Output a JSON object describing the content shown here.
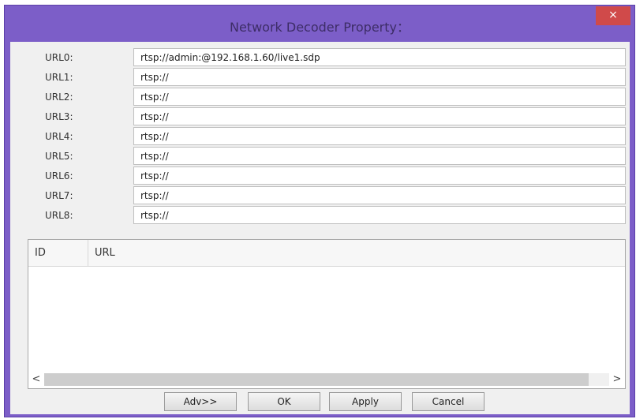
{
  "window": {
    "title": "Network Decoder Property：",
    "close_glyph": "×"
  },
  "urls": [
    {
      "label": "URL0:",
      "value": "rtsp://admin:@192.168.1.60/live1.sdp"
    },
    {
      "label": "URL1:",
      "value": "rtsp://"
    },
    {
      "label": "URL2:",
      "value": "rtsp://"
    },
    {
      "label": "URL3:",
      "value": "rtsp://"
    },
    {
      "label": "URL4:",
      "value": "rtsp://"
    },
    {
      "label": "URL5:",
      "value": "rtsp://"
    },
    {
      "label": "URL6:",
      "value": "rtsp://"
    },
    {
      "label": "URL7:",
      "value": "rtsp://"
    },
    {
      "label": "URL8:",
      "value": "rtsp://"
    }
  ],
  "list": {
    "columns": [
      "ID",
      "URL"
    ],
    "scroll_left": "<",
    "scroll_right": ">"
  },
  "buttons": {
    "adv": "Adv>>",
    "ok": "OK",
    "apply": "Apply",
    "cancel": "Cancel"
  },
  "colors": {
    "titlebar": "#7c5ec8",
    "close_button": "#d04a4a",
    "client_bg": "#f0f0f0"
  }
}
